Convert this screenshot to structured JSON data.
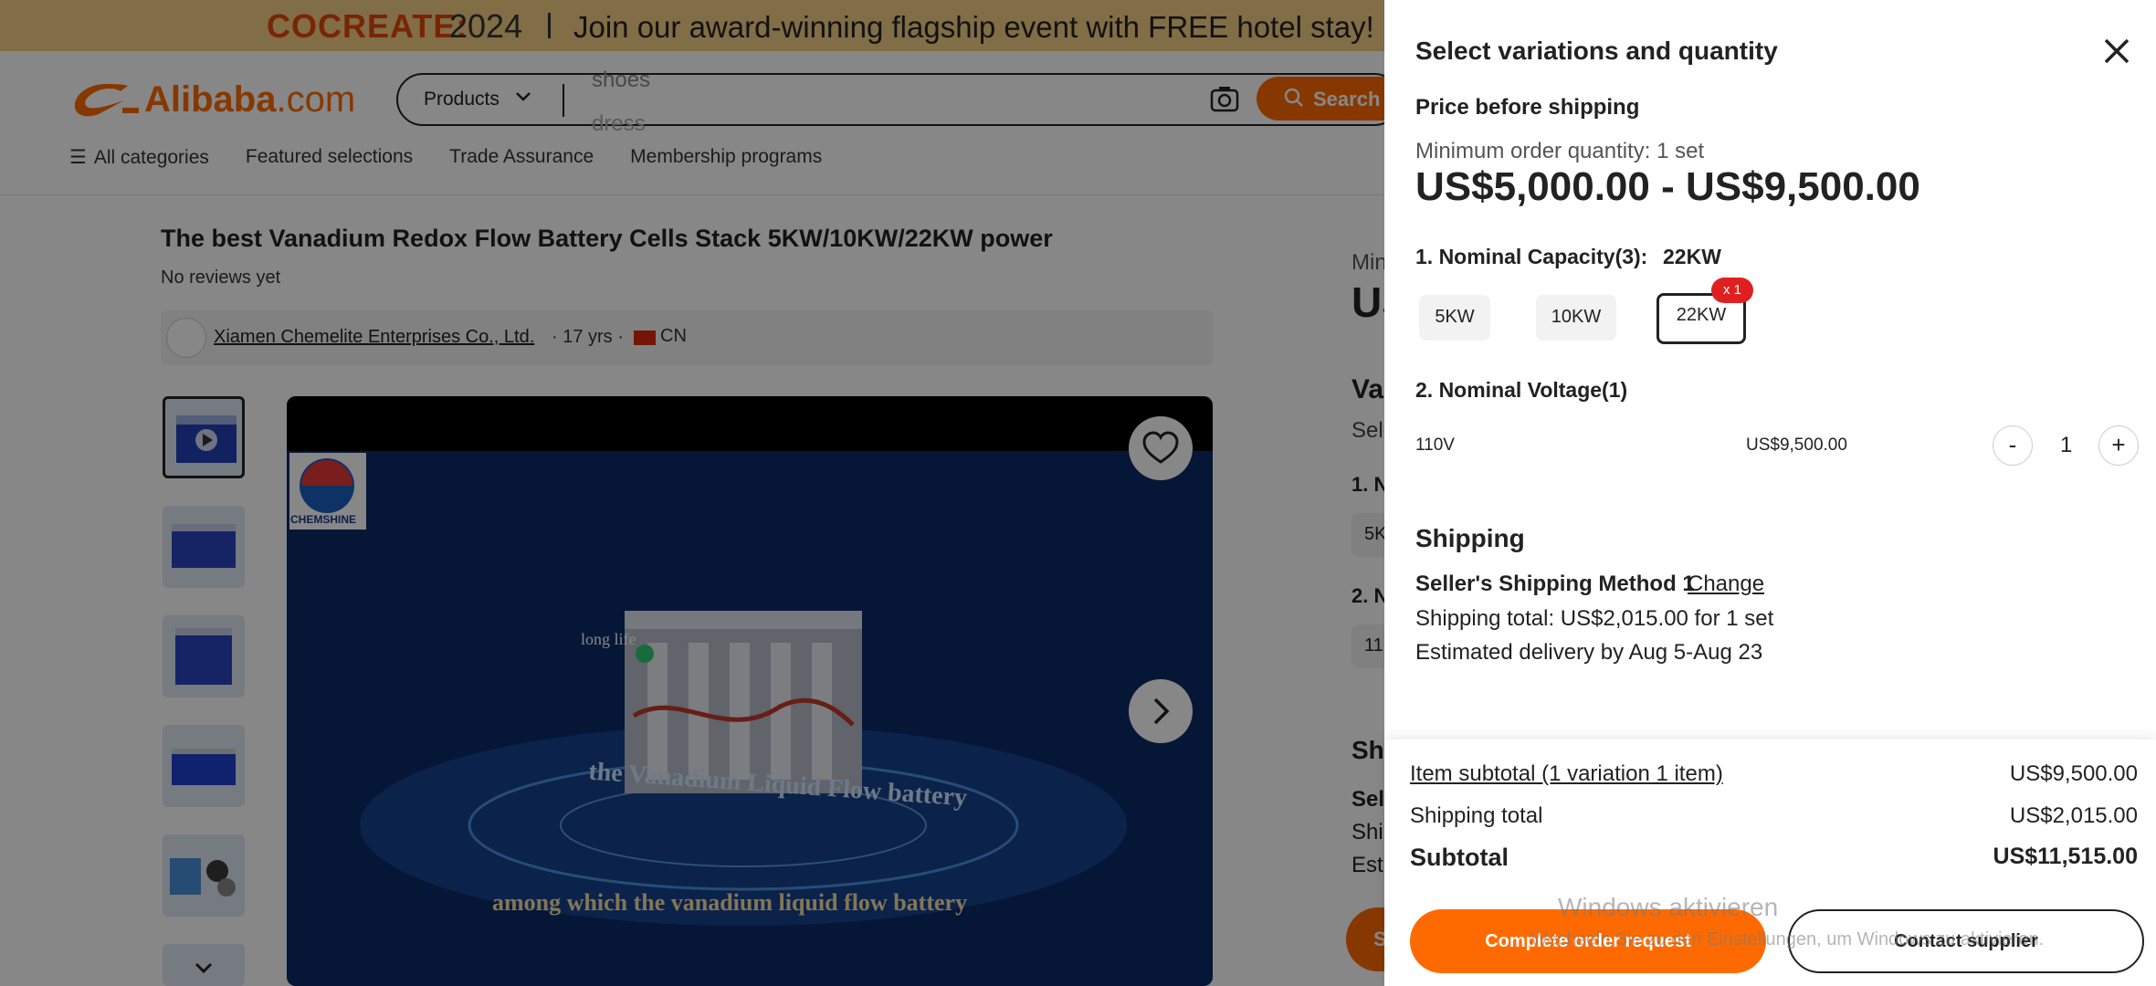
{
  "banner": {
    "brand": "COCREATE:",
    "year": "2024",
    "message": "Join our award-winning flagship event with FREE hotel stay!"
  },
  "header": {
    "logo_text_a": "Alibaba",
    "logo_text_b": ".com",
    "search_category": "Products",
    "search_keyword": "shoes",
    "search_keyword_next": "dress",
    "search_button": "Search",
    "nav": [
      "All categories",
      "Featured selections",
      "Trade Assurance",
      "Membership programs"
    ]
  },
  "product": {
    "title": "The best Vanadium Redox Flow Battery Cells Stack 5KW/10KW/22KW power",
    "reviews": "No reviews yet",
    "supplier_name": "Xiamen Chemelite Enterprises Co., Ltd.",
    "supplier_years": "· 17 yrs ·",
    "supplier_country": "CN",
    "image_logo_text": "CHEMSHINE",
    "image_caption": "among which the vanadium liquid flow battery",
    "image_label": "long life",
    "image_title_art": "the Vanadium Liquid Flow battery"
  },
  "right_panel_partial": {
    "min": "Min",
    "price": "US",
    "variations": "Var",
    "select": "Sele",
    "opt1": "1. N",
    "chip1": "5K",
    "opt2": "2. N",
    "chip2": "11",
    "shipping": "Shi",
    "seller": "Sel",
    "ship": "Ship",
    "est": "Est",
    "btn": "S"
  },
  "modal": {
    "title": "Select variations and quantity",
    "price_label": "Price before shipping",
    "moq": "Minimum order quantity: 1 set",
    "price_range": "US$5,000.00 - US$9,500.00",
    "capacity_label": "1. Nominal Capacity(3):",
    "capacity_selected": "22KW",
    "capacity_options": [
      "5KW",
      "10KW",
      "22KW"
    ],
    "capacity_badge": "x 1",
    "voltage_label": "2. Nominal Voltage(1)",
    "voltage_option": "110V",
    "voltage_price": "US$9,500.00",
    "qty_minus": "-",
    "qty_value": "1",
    "qty_plus": "+",
    "shipping_heading": "Shipping",
    "shipping_method": "Seller's Shipping Method 1",
    "shipping_change": "Change",
    "shipping_total_line": "Shipping total: US$2,015.00 for 1 set",
    "delivery_line": "Estimated delivery by Aug 5-Aug 23"
  },
  "footer": {
    "item_subtotal_label": "Item subtotal (1 variation 1 item)",
    "item_subtotal_value": "US$9,500.00",
    "shipping_total_label": "Shipping total",
    "shipping_total_value": "US$2,015.00",
    "subtotal_label": "Subtotal",
    "subtotal_value": "US$11,515.00",
    "complete_btn": "Complete order request",
    "contact_btn": "Contact supplier"
  },
  "watermark": {
    "line1": "Windows aktivieren",
    "line2": "Wechseln Sie zu den Einstellungen, um Windows zu aktivieren."
  },
  "colors": {
    "accent": "#ff6a00",
    "banner_bg": "#f3cf84",
    "badge": "#e02020"
  }
}
